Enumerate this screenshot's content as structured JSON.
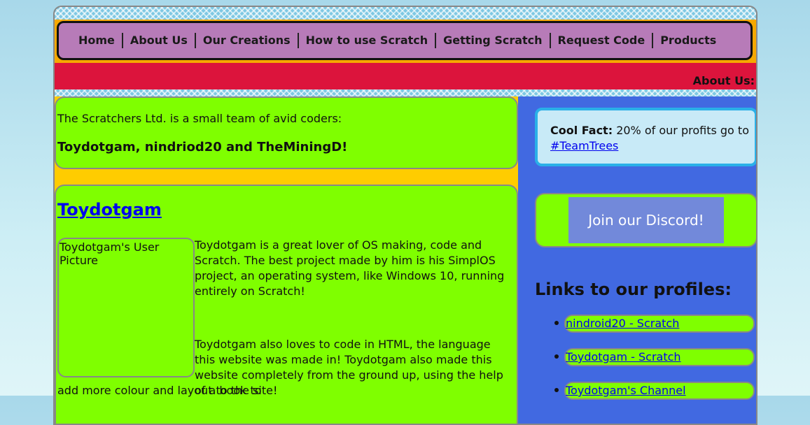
{
  "nav": {
    "items": [
      "Home",
      "About Us",
      "Our Creations",
      "How to use Scratch",
      "Getting Scratch",
      "Request Code",
      "Products"
    ]
  },
  "marquee": "About Us:",
  "intro": {
    "line1": "The Scratchers Ltd. is a small team of avid coders:",
    "line2": "Toydotgam, nindriod20 and TheMiningD!"
  },
  "profile": {
    "name": "Toydotgam",
    "picture_alt": "Toydotgam's User Picture",
    "para1": "Toydotgam is a great lover of OS making, code and Scratch. The best project made by him is his SimplOS project, an operating system, like Windows 10, running entirely on Scratch!",
    "para2_a": "Toydotgam also loves to code in HTML, the language this website was made in! Toydotgam also made this website completely from the ground up, using the help of a book to",
    "para2_b": "add more colour and layout to the site!"
  },
  "fact": {
    "label": "Cool Fact:",
    "text": " 20% of our profits go to ",
    "link": "#TeamTrees"
  },
  "discord": {
    "label": "Join our Discord!"
  },
  "links": {
    "title": "Links to our profiles:",
    "items": [
      "nindroid20 - Scratch",
      "Toydotgam - Scratch",
      "Toydotgam's Channel"
    ]
  }
}
